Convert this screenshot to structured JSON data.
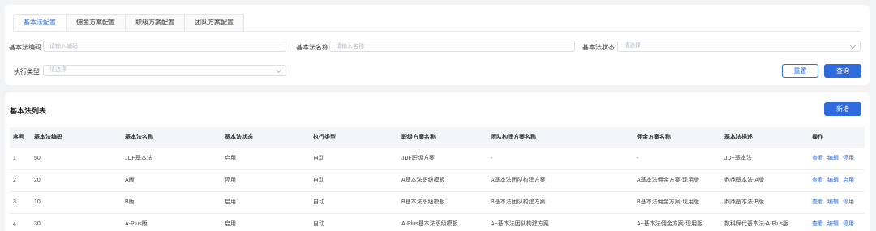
{
  "tabs": [
    "基本法配置",
    "佣金方案配置",
    "职级方案配置",
    "团队方案配置"
  ],
  "filters": {
    "code_label": "基本法编码",
    "code_placeholder": "请输入编码",
    "name_label": "基本法名称",
    "name_placeholder": "请输入名称",
    "status_label": "基本法状态:",
    "status_placeholder": "请选择",
    "exec_label": "执行类型",
    "exec_placeholder": "请选择"
  },
  "buttons": {
    "reset": "重置",
    "search": "查询",
    "add": "新增"
  },
  "list": {
    "title": "基本法列表",
    "columns": [
      "序号",
      "基本法编码",
      "基本法名称",
      "基本法状态",
      "执行类型",
      "职级方案名称",
      "团队构建方案名称",
      "佣金方案名称",
      "基本法描述",
      "操作"
    ],
    "rows": [
      {
        "no": "1",
        "code": "50",
        "name": "JDF基本法",
        "status": "启用",
        "exec": "自动",
        "rank": "JDF职级方案",
        "team": "-",
        "comm": "-",
        "desc": "JDF基本法",
        "actions": [
          "查看",
          "编辑",
          "停用"
        ]
      },
      {
        "no": "2",
        "code": "20",
        "name": "A版",
        "status": "停用",
        "exec": "自动",
        "rank": "A基本法职级模板",
        "team": "A基本法团队构建方案",
        "comm": "A基本法佣金方案-现用版",
        "desc": "鼎鼎基本法-A版",
        "actions": [
          "查看",
          "编辑",
          "启用"
        ]
      },
      {
        "no": "3",
        "code": "10",
        "name": "B版",
        "status": "启用",
        "exec": "自动",
        "rank": "B基本法职级模板",
        "team": "B基本法团队构建方案",
        "comm": "B基本法佣金方案-现用版",
        "desc": "鼎鼎基本法-B版",
        "actions": [
          "查看",
          "编辑",
          "停用"
        ]
      },
      {
        "no": "4",
        "code": "30",
        "name": "A-Plus版",
        "status": "启用",
        "exec": "自动",
        "rank": "A-Plus基本法职级模板",
        "team": "A+基本法团队构建方案",
        "comm": "A+基本法佣金方案-现用版",
        "desc": "数科保代基本法-A-Plus版",
        "actions": [
          "查看",
          "编辑",
          "停用"
        ]
      }
    ]
  },
  "colors": {
    "accent": "#2f6bdc",
    "background": "#f2f3f5"
  }
}
